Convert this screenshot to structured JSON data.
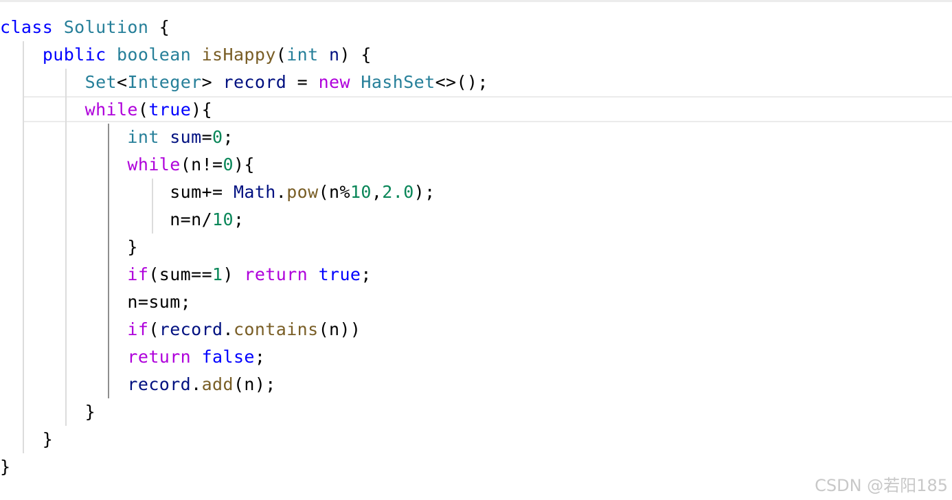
{
  "watermark": "CSDN @若阳185",
  "colors": {
    "keyword": "#0000ff",
    "control": "#af00db",
    "type": "#267f99",
    "variable": "#001080",
    "function": "#795e26",
    "number": "#098658",
    "text": "#000000"
  },
  "code": {
    "language": "java",
    "lines": [
      [
        {
          "t": "class",
          "c": "keyword"
        },
        {
          "t": " ",
          "c": "punct"
        },
        {
          "t": "Solution",
          "c": "type"
        },
        {
          "t": " {",
          "c": "punct"
        }
      ],
      [
        {
          "t": "    ",
          "c": "punct"
        },
        {
          "t": "public",
          "c": "keyword"
        },
        {
          "t": " ",
          "c": "punct"
        },
        {
          "t": "boolean",
          "c": "type"
        },
        {
          "t": " ",
          "c": "punct"
        },
        {
          "t": "isHappy",
          "c": "func"
        },
        {
          "t": "(",
          "c": "punct"
        },
        {
          "t": "int",
          "c": "type"
        },
        {
          "t": " ",
          "c": "punct"
        },
        {
          "t": "n",
          "c": "var"
        },
        {
          "t": ") {",
          "c": "punct"
        }
      ],
      [
        {
          "t": "        ",
          "c": "punct"
        },
        {
          "t": "Set",
          "c": "type"
        },
        {
          "t": "<",
          "c": "punct"
        },
        {
          "t": "Integer",
          "c": "type"
        },
        {
          "t": "> ",
          "c": "punct"
        },
        {
          "t": "record",
          "c": "var"
        },
        {
          "t": " = ",
          "c": "punct"
        },
        {
          "t": "new",
          "c": "control"
        },
        {
          "t": " ",
          "c": "punct"
        },
        {
          "t": "HashSet",
          "c": "type"
        },
        {
          "t": "<>();",
          "c": "punct"
        }
      ],
      [
        {
          "t": "        ",
          "c": "punct"
        },
        {
          "t": "while",
          "c": "control"
        },
        {
          "t": "(",
          "c": "punct"
        },
        {
          "t": "true",
          "c": "keyword"
        },
        {
          "t": "){",
          "c": "punct"
        }
      ],
      [
        {
          "t": "            ",
          "c": "punct"
        },
        {
          "t": "int",
          "c": "type"
        },
        {
          "t": " ",
          "c": "punct"
        },
        {
          "t": "sum",
          "c": "var"
        },
        {
          "t": "=",
          "c": "punct"
        },
        {
          "t": "0",
          "c": "number"
        },
        {
          "t": ";",
          "c": "punct"
        }
      ],
      [
        {
          "t": "            ",
          "c": "punct"
        },
        {
          "t": "while",
          "c": "control"
        },
        {
          "t": "(n!=",
          "c": "punct"
        },
        {
          "t": "0",
          "c": "number"
        },
        {
          "t": "){",
          "c": "punct"
        }
      ],
      [
        {
          "t": "                ",
          "c": "punct"
        },
        {
          "t": "sum+= ",
          "c": "punct"
        },
        {
          "t": "Math",
          "c": "var"
        },
        {
          "t": ".",
          "c": "punct"
        },
        {
          "t": "pow",
          "c": "func"
        },
        {
          "t": "(n%",
          "c": "punct"
        },
        {
          "t": "10",
          "c": "number"
        },
        {
          "t": ",",
          "c": "punct"
        },
        {
          "t": "2.0",
          "c": "number"
        },
        {
          "t": ");",
          "c": "punct"
        }
      ],
      [
        {
          "t": "                ",
          "c": "punct"
        },
        {
          "t": "n=n/",
          "c": "punct"
        },
        {
          "t": "10",
          "c": "number"
        },
        {
          "t": ";",
          "c": "punct"
        }
      ],
      [
        {
          "t": "            }",
          "c": "punct"
        }
      ],
      [
        {
          "t": "            ",
          "c": "punct"
        },
        {
          "t": "if",
          "c": "control"
        },
        {
          "t": "(sum==",
          "c": "punct"
        },
        {
          "t": "1",
          "c": "number"
        },
        {
          "t": ") ",
          "c": "punct"
        },
        {
          "t": "return",
          "c": "control"
        },
        {
          "t": " ",
          "c": "punct"
        },
        {
          "t": "true",
          "c": "keyword"
        },
        {
          "t": ";",
          "c": "punct"
        }
      ],
      [
        {
          "t": "            n=sum;",
          "c": "punct"
        }
      ],
      [
        {
          "t": "            ",
          "c": "punct"
        },
        {
          "t": "if",
          "c": "control"
        },
        {
          "t": "(",
          "c": "punct"
        },
        {
          "t": "record",
          "c": "var"
        },
        {
          "t": ".",
          "c": "punct"
        },
        {
          "t": "contains",
          "c": "func"
        },
        {
          "t": "(n))",
          "c": "punct"
        }
      ],
      [
        {
          "t": "            ",
          "c": "punct"
        },
        {
          "t": "return",
          "c": "control"
        },
        {
          "t": " ",
          "c": "punct"
        },
        {
          "t": "false",
          "c": "keyword"
        },
        {
          "t": ";",
          "c": "punct"
        }
      ],
      [
        {
          "t": "            ",
          "c": "punct"
        },
        {
          "t": "record",
          "c": "var"
        },
        {
          "t": ".",
          "c": "punct"
        },
        {
          "t": "add",
          "c": "func"
        },
        {
          "t": "(n);",
          "c": "punct"
        }
      ],
      [
        {
          "t": "        }",
          "c": "punct"
        }
      ],
      [
        {
          "t": "    }",
          "c": "punct"
        }
      ],
      [
        {
          "t": "}",
          "c": "punct"
        }
      ]
    ]
  }
}
